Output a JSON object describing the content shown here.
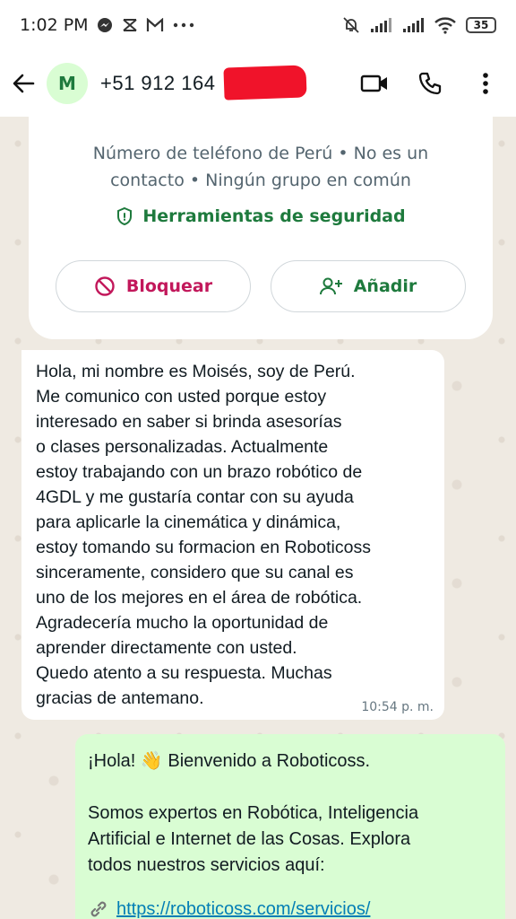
{
  "status_bar": {
    "time": "1:02 PM",
    "battery": "35"
  },
  "header": {
    "avatar_initial": "M",
    "contact_name": "+51 912 164"
  },
  "info_card": {
    "description": "Número de teléfono de Perú • No es un contacto • Ningún grupo en común",
    "security_label": "Herramientas de seguridad",
    "block_label": "Bloquear",
    "add_label": "Añadir"
  },
  "incoming_message": {
    "text": "Hola, mi nombre es Moisés, soy de Perú.\nMe comunico con usted porque estoy\ninteresado en saber si brinda asesorías\no clases personalizadas. Actualmente\nestoy trabajando con un brazo robótico de\n4GDL y me gustaría contar con su ayuda\npara aplicarle la cinemática y dinámica,\nestoy tomando su formacion en Roboticoss\nsinceramente, considero que su canal es\nuno de los mejores en el área de robótica.\nAgradecería mucho la oportunidad de\naprender directamente con usted.\nQuedo atento a su respuesta. Muchas\ngracias de antemano.",
    "time": "10:54 p. m."
  },
  "outgoing_message": {
    "greeting_prefix": "¡Hola!",
    "greeting_emoji": "👋",
    "greeting_suffix": "Bienvenido a Roboticoss.",
    "paragraph": "Somos expertos en Robótica, Inteligencia\nArtificial e Internet de las Cosas. Explora\ntodos nuestros servicios aquí:",
    "link": "https://roboticoss.com/servicios/"
  },
  "colors": {
    "accent_green": "#1e7a3d",
    "block_red": "#c2185b",
    "outgoing_bubble": "#d9fdd3",
    "chat_background": "#efeae2"
  }
}
